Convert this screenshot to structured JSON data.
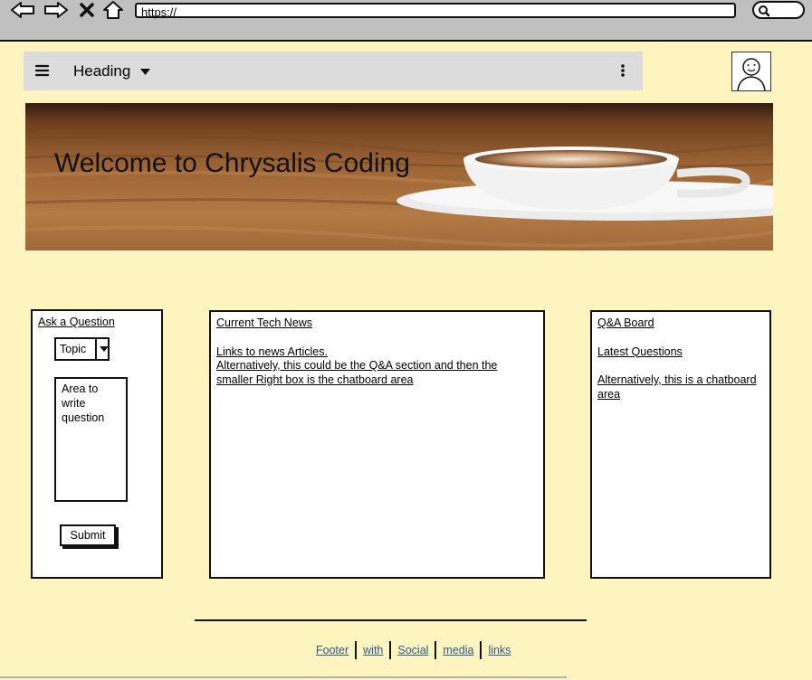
{
  "browser": {
    "url": "https://",
    "icons": [
      "back-arrow-icon",
      "forward-arrow-icon",
      "close-icon",
      "home-icon",
      "search-icon"
    ]
  },
  "appbar": {
    "heading": "Heading",
    "icons": [
      "hamburger-menu-icon",
      "caret-down-icon",
      "vertical-dots-icon"
    ]
  },
  "hero": {
    "title": "Welcome to Chrysalis Coding"
  },
  "ask_panel": {
    "title": "Ask a Question",
    "topic_select": "Topic",
    "textarea_text": "Area to write question",
    "submit_label": "Submit"
  },
  "news_panel": {
    "title": "Current Tech News",
    "line1": "Links to news Articles.",
    "line2": "Alternatively, this could be the Q&A section and then the",
    "line3": "smaller Right box is the chatboard area"
  },
  "qa_panel": {
    "title": "Q&A Board",
    "latest": "Latest Questions",
    "alt1": "Alternatively, this is a chatboard",
    "alt2": "area"
  },
  "footer": {
    "links": [
      "Footer",
      "with",
      "Social",
      "media",
      "links"
    ]
  },
  "colors": {
    "page_background": "#fdf4bf",
    "browser_chrome": "#c0c0c0",
    "appbar_background": "#dcdcdc",
    "footer_link": "#2a5a8a"
  }
}
